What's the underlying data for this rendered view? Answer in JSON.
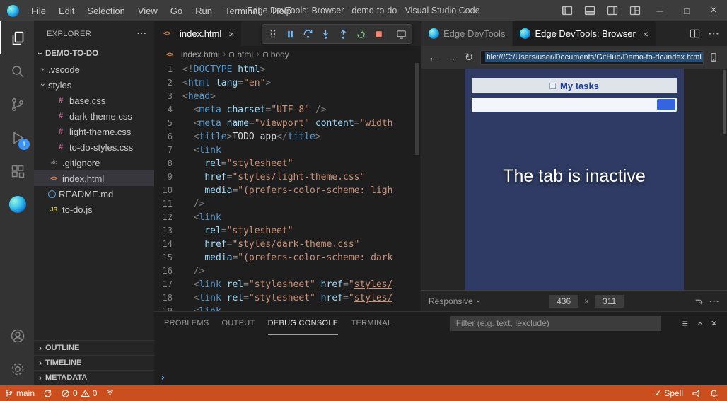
{
  "colors": {
    "statusbar": "#ca4e1e",
    "badge": "#3794ff",
    "accent": "#0078d4",
    "page_blue": "#44568f",
    "tag": "#569cd6",
    "attr": "#9cdcfe",
    "string": "#ce9178",
    "punct": "#808080",
    "code_text": "#d4d4d4"
  },
  "window": {
    "title": "Edge DevTools: Browser - demo-to-do - Visual Studio Code",
    "menus": [
      "File",
      "Edit",
      "Selection",
      "View",
      "Go",
      "Run",
      "Terminal",
      "Help"
    ]
  },
  "activity_bar": {
    "debug_badge": "1"
  },
  "sidebar": {
    "title": "EXPLORER",
    "root": "DEMO-TO-DO",
    "files": [
      {
        "label": ".vscode",
        "indent": 1,
        "icon": "folder",
        "chevron": true
      },
      {
        "label": "styles",
        "indent": 1,
        "icon": "folder",
        "chevron": true
      },
      {
        "label": "base.css",
        "indent": 2,
        "icon": "css",
        "chevron": false
      },
      {
        "label": "dark-theme.css",
        "indent": 2,
        "icon": "css",
        "chevron": false
      },
      {
        "label": "light-theme.css",
        "indent": 2,
        "icon": "css",
        "chevron": false
      },
      {
        "label": "to-do-styles.css",
        "indent": 2,
        "icon": "css",
        "chevron": false
      },
      {
        "label": ".gitignore",
        "indent": 1,
        "icon": "gear",
        "chevron": false
      },
      {
        "label": "index.html",
        "indent": 1,
        "icon": "html",
        "chevron": false,
        "selected": true
      },
      {
        "label": "README.md",
        "indent": 1,
        "icon": "info",
        "chevron": false
      },
      {
        "label": "to-do.js",
        "indent": 1,
        "icon": "js",
        "chevron": false
      }
    ],
    "sections": [
      "OUTLINE",
      "TIMELINE",
      "METADATA"
    ]
  },
  "editor": {
    "tab": "index.html",
    "breadcrumb": [
      "index.html",
      "html",
      "body"
    ],
    "lines": [
      [
        [
          "p",
          "<!"
        ],
        [
          "t",
          "DOCTYPE"
        ],
        [
          "a",
          " html"
        ],
        [
          "p",
          ">"
        ]
      ],
      [
        [
          "p",
          "<"
        ],
        [
          "t",
          "html"
        ],
        [
          "a",
          " lang"
        ],
        [
          "p",
          "="
        ],
        [
          "s",
          "\"en\""
        ],
        [
          "p",
          ">"
        ]
      ],
      [
        [
          "p",
          "<"
        ],
        [
          "t",
          "head"
        ],
        [
          "p",
          ">"
        ]
      ],
      [
        [
          "x",
          "  "
        ],
        [
          "p",
          "<"
        ],
        [
          "t",
          "meta"
        ],
        [
          "a",
          " charset"
        ],
        [
          "p",
          "="
        ],
        [
          "s",
          "\"UTF-8\""
        ],
        [
          "x",
          " "
        ],
        [
          "p",
          "/>"
        ]
      ],
      [
        [
          "x",
          "  "
        ],
        [
          "p",
          "<"
        ],
        [
          "t",
          "meta"
        ],
        [
          "a",
          " name"
        ],
        [
          "p",
          "="
        ],
        [
          "s",
          "\"viewport\""
        ],
        [
          "a",
          " content"
        ],
        [
          "p",
          "="
        ],
        [
          "s",
          "\"width"
        ]
      ],
      [
        [
          "x",
          "  "
        ],
        [
          "p",
          "<"
        ],
        [
          "t",
          "title"
        ],
        [
          "p",
          ">"
        ],
        [
          "x",
          "TODO app"
        ],
        [
          "p",
          "</"
        ],
        [
          "t",
          "title"
        ],
        [
          "p",
          ">"
        ]
      ],
      [
        [
          "x",
          "  "
        ],
        [
          "p",
          "<"
        ],
        [
          "t",
          "link"
        ]
      ],
      [
        [
          "x",
          "    "
        ],
        [
          "a",
          "rel"
        ],
        [
          "p",
          "="
        ],
        [
          "s",
          "\"stylesheet\""
        ]
      ],
      [
        [
          "x",
          "    "
        ],
        [
          "a",
          "href"
        ],
        [
          "p",
          "="
        ],
        [
          "s",
          "\"styles/light-theme.css\""
        ]
      ],
      [
        [
          "x",
          "    "
        ],
        [
          "a",
          "media"
        ],
        [
          "p",
          "="
        ],
        [
          "s",
          "\"(prefers-color-scheme: ligh"
        ]
      ],
      [
        [
          "x",
          "  "
        ],
        [
          "p",
          "/>"
        ]
      ],
      [
        [
          "x",
          "  "
        ],
        [
          "p",
          "<"
        ],
        [
          "t",
          "link"
        ]
      ],
      [
        [
          "x",
          "    "
        ],
        [
          "a",
          "rel"
        ],
        [
          "p",
          "="
        ],
        [
          "s",
          "\"stylesheet\""
        ]
      ],
      [
        [
          "x",
          "    "
        ],
        [
          "a",
          "href"
        ],
        [
          "p",
          "="
        ],
        [
          "s",
          "\"styles/dark-theme.css\""
        ]
      ],
      [
        [
          "x",
          "    "
        ],
        [
          "a",
          "media"
        ],
        [
          "p",
          "="
        ],
        [
          "s",
          "\"(prefers-color-scheme: dark"
        ]
      ],
      [
        [
          "x",
          "  "
        ],
        [
          "p",
          "/>"
        ]
      ],
      [
        [
          "x",
          "  "
        ],
        [
          "p",
          "<"
        ],
        [
          "t",
          "link"
        ],
        [
          "a",
          " rel"
        ],
        [
          "p",
          "="
        ],
        [
          "s",
          "\"stylesheet\""
        ],
        [
          "a",
          " href"
        ],
        [
          "p",
          "="
        ],
        [
          "s",
          "\""
        ],
        [
          "u",
          "styles/"
        ]
      ],
      [
        [
          "x",
          "  "
        ],
        [
          "p",
          "<"
        ],
        [
          "t",
          "link"
        ],
        [
          "a",
          " rel"
        ],
        [
          "p",
          "="
        ],
        [
          "s",
          "\"stylesheet\""
        ],
        [
          "a",
          " href"
        ],
        [
          "p",
          "="
        ],
        [
          "s",
          "\""
        ],
        [
          "u",
          "styles/"
        ]
      ],
      [
        [
          "x",
          "  "
        ],
        [
          "p",
          "<"
        ],
        [
          "t",
          "link"
        ]
      ]
    ]
  },
  "devtools": {
    "tab_inactive": "Edge DevTools",
    "tab_active": "Edge DevTools: Browser",
    "url": "file:///C:/Users/user/Documents/GitHub/Demo-to-do/index.html",
    "page_title": "My tasks",
    "overlay_text": "The tab is inactive",
    "device": "Responsive",
    "viewport_width": "436",
    "dim_separator": "×",
    "viewport_height": "311"
  },
  "panel": {
    "tabs": [
      "PROBLEMS",
      "OUTPUT",
      "DEBUG CONSOLE",
      "TERMINAL"
    ],
    "active_tab": "DEBUG CONSOLE",
    "filter_placeholder": "Filter (e.g. text, !exclude)",
    "prompt": "›"
  },
  "status_bar": {
    "branch": "main",
    "errors": "0",
    "warnings": "0",
    "spell": "Spell"
  }
}
